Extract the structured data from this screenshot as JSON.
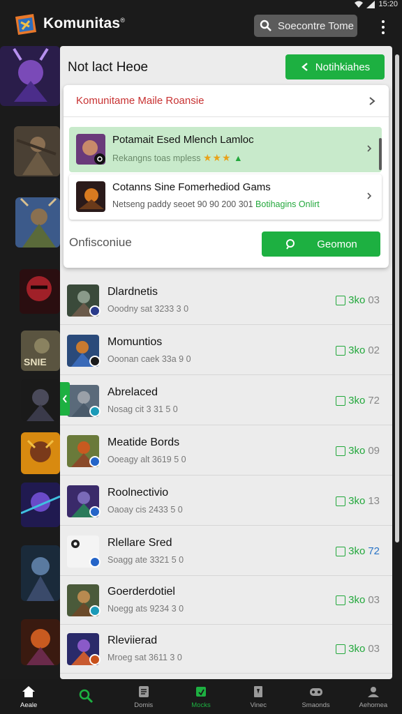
{
  "status": {
    "time": "15:20"
  },
  "header": {
    "title": "Komunitas",
    "search_label": "Soecontre Tome"
  },
  "panel": {
    "title": "Not lact Heoe",
    "notif_button": "Notihkiahes",
    "card_header": "Komunitame Maile Roansie",
    "events": [
      {
        "title": "Potamait Esed Mlench Lamloc",
        "subtitle": "Rekangns toas mpless",
        "stars": "★★★"
      },
      {
        "title": "Cotanns Sine Fomerhediod Gams",
        "subtitle": "Netseng paddy seoet 90 90 200 301",
        "highlight": "Botihagins Onlirt"
      }
    ],
    "online_label": "Onfisconiue",
    "gecation_button": "Geomon"
  },
  "list": [
    {
      "title": "Dlardnetis",
      "subtitle": "Ooodny sat 3233 3 0",
      "stat_label": "3ko",
      "stat_value": "03",
      "stat_tone": "dim"
    },
    {
      "title": "Momuntios",
      "subtitle": "Ooonan caek 33a 9 0",
      "stat_label": "3ko",
      "stat_value": "02",
      "stat_tone": "dim"
    },
    {
      "title": "Abrelaced",
      "subtitle": "Nosag cit 3 31 5 0",
      "stat_label": "3ko",
      "stat_value": "72",
      "stat_tone": "dim"
    },
    {
      "title": "Meatide Bords",
      "subtitle": "Ooeagy alt 3619 5 0",
      "stat_label": "3ko",
      "stat_value": "09",
      "stat_tone": "dim"
    },
    {
      "title": "Roolnectivio",
      "subtitle": "Oaoay cis 2433 5 0",
      "stat_label": "3ko",
      "stat_value": "13",
      "stat_tone": "dim"
    },
    {
      "title": "Rlellare Sred",
      "subtitle": "Soagg ate 3321 5 0",
      "stat_label": "3ko",
      "stat_value": "72",
      "stat_tone": "blue"
    },
    {
      "title": "Goerderdotiel",
      "subtitle": "Noegg ats 9234 3 0",
      "stat_label": "3ko",
      "stat_value": "03",
      "stat_tone": "dim"
    },
    {
      "title": "Rleviierad",
      "subtitle": "Mroeg sat 3611 3 0",
      "stat_label": "3ko",
      "stat_value": "03",
      "stat_tone": "dim"
    }
  ],
  "bottom_nav": [
    {
      "label": "Aeale",
      "icon": "home-icon"
    },
    {
      "label": "",
      "icon": "search-icon"
    },
    {
      "label": "Domis",
      "icon": "document-icon"
    },
    {
      "label": "Mocks",
      "icon": "calendar-icon"
    },
    {
      "label": "Vinec",
      "icon": "game-icon"
    },
    {
      "label": "Smaonds",
      "icon": "controller-icon"
    },
    {
      "label": "Aehomea",
      "icon": "profile-icon"
    }
  ],
  "colors": {
    "accent": "#1db041",
    "panel": "#ececec",
    "background": "#1b1b1b",
    "alert": "#c83232"
  }
}
